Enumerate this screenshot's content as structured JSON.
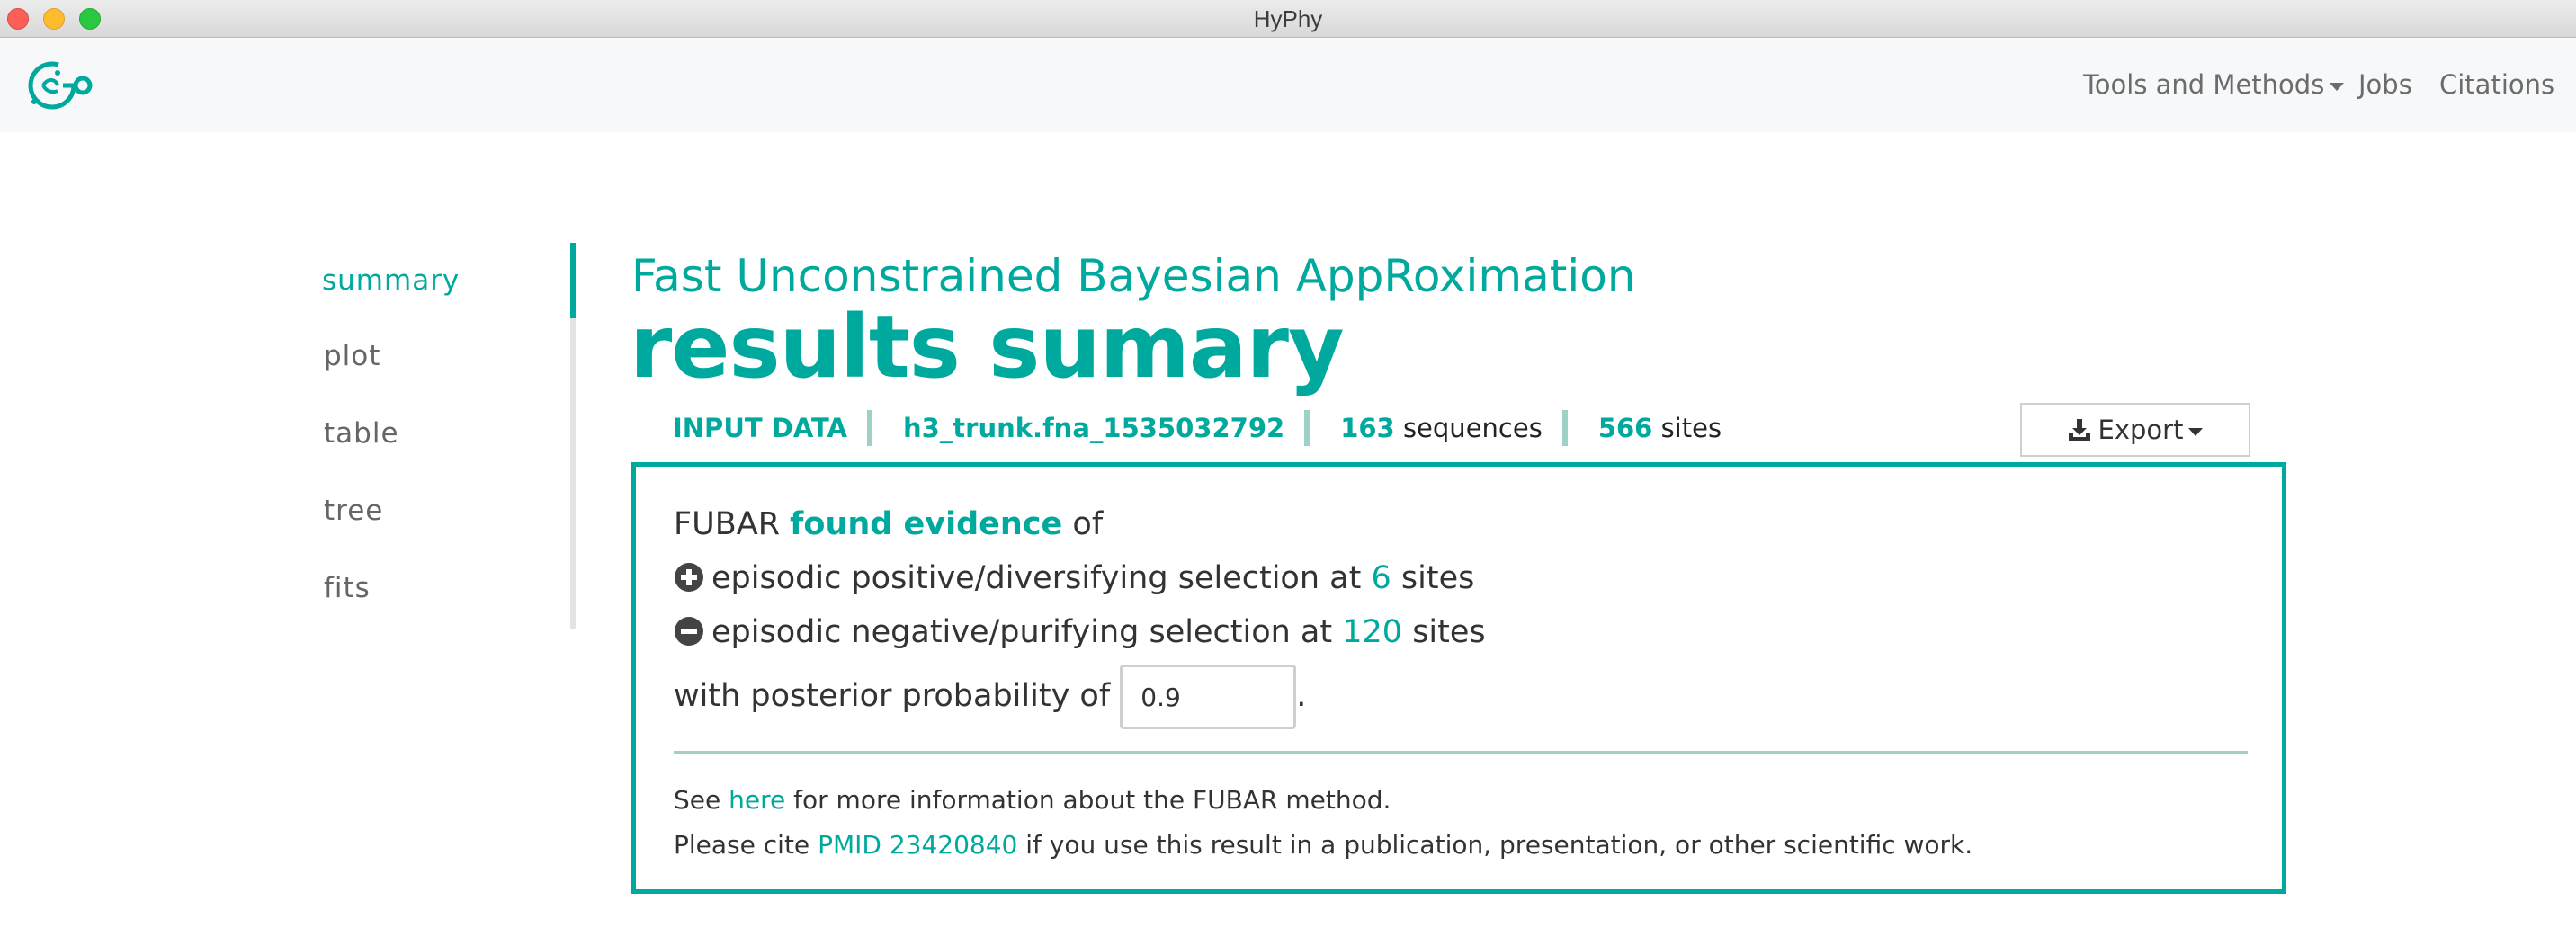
{
  "window": {
    "title": "HyPhy"
  },
  "navbar": {
    "logo": "hyphy-logo",
    "tools_label": "Tools and Methods",
    "jobs_label": "Jobs",
    "citations_label": "Citations"
  },
  "sidenav": {
    "items": [
      {
        "label": "summary",
        "active": true
      },
      {
        "label": "plot",
        "active": false
      },
      {
        "label": "table",
        "active": false
      },
      {
        "label": "tree",
        "active": false
      },
      {
        "label": "fits",
        "active": false
      }
    ]
  },
  "header": {
    "subtitle": "Fast Unconstrained Bayesian AppRoximation",
    "title": "results sumary"
  },
  "input_data": {
    "label": "INPUT DATA",
    "filename": "h3_trunk.fna_1535032792",
    "sequences_count": "163",
    "sequences_label": "sequences",
    "sites_count": "566",
    "sites_label": "sites"
  },
  "export": {
    "label": "Export",
    "icon": "download-icon"
  },
  "summary": {
    "intro_prefix": "FUBAR",
    "intro_emph": "found evidence",
    "intro_suffix": "of",
    "positive_prefix": "episodic positive/diversifying selection at",
    "positive_count": "6",
    "positive_suffix": "sites",
    "negative_prefix": "episodic negative/purifying selection at",
    "negative_count": "120",
    "negative_suffix": "sites",
    "prob_prefix": "with posterior probability of",
    "prob_value": "0.9",
    "prob_suffix": ".",
    "info_prefix": "See",
    "info_link": "here",
    "info_suffix": "for more information about the FUBAR method.",
    "cite_prefix": "Please cite",
    "cite_link": "PMID 23420840",
    "cite_suffix": "if you use this result in a publication, presentation, or other scientific work."
  },
  "colors": {
    "accent": "#00a99d",
    "divider": "#a5cdc3"
  }
}
